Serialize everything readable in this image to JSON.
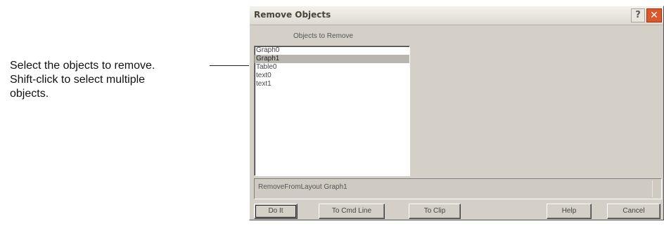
{
  "annotation": {
    "lines": [
      "Select the objects to remove.",
      "Shift-click to select multiple",
      "objects."
    ]
  },
  "dialog": {
    "title": "Remove Objects",
    "help_glyph": "?",
    "close_glyph": "✕",
    "list_label": "Objects to Remove",
    "list_items": [
      "Graph0",
      "Graph1",
      "Table0",
      "text0",
      "text1"
    ],
    "selected_item": "Graph1",
    "command_text": "RemoveFromLayout Graph1",
    "buttons": {
      "do_it": "Do It",
      "to_cmd_line": "To Cmd Line",
      "to_clip": "To Clip",
      "help": "Help",
      "cancel": "Cancel"
    }
  },
  "icons": {
    "help": "question-mark-icon",
    "close": "close-icon"
  }
}
